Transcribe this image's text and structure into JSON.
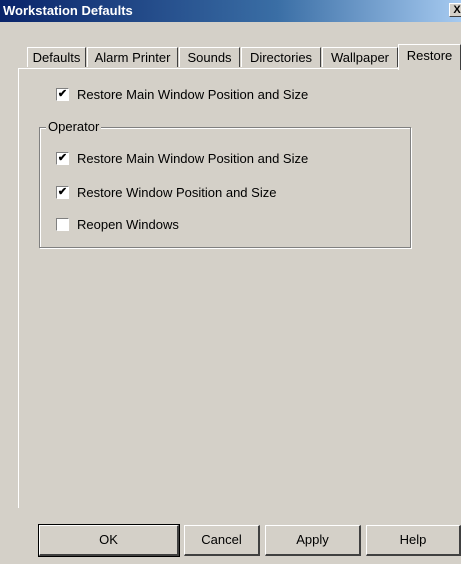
{
  "window": {
    "title": "Workstation Defaults",
    "close_glyph": "X"
  },
  "tabs": [
    {
      "label": "Defaults",
      "active": false
    },
    {
      "label": "Alarm Printer",
      "active": false
    },
    {
      "label": "Sounds",
      "active": false
    },
    {
      "label": "Directories",
      "active": false
    },
    {
      "label": "Wallpaper",
      "active": false
    },
    {
      "label": "Restore",
      "active": true
    }
  ],
  "restore": {
    "main_window": {
      "label": "Restore Main Window Position and Size",
      "checked": true
    },
    "operator_group": {
      "label": "Operator",
      "main_window": {
        "label": "Restore Main Window Position and Size",
        "checked": true
      },
      "window_pos": {
        "label": "Restore Window Position and Size",
        "checked": true
      },
      "reopen": {
        "label": "Reopen Windows",
        "checked": false
      }
    }
  },
  "buttons": {
    "ok": "OK",
    "cancel": "Cancel",
    "apply": "Apply",
    "help": "Help"
  },
  "colors": {
    "face": "#d4d0c8",
    "title_start": "#0a246a",
    "title_end": "#a6caf0"
  },
  "icons": {
    "close": "close-icon",
    "check": "checkmark-icon"
  }
}
